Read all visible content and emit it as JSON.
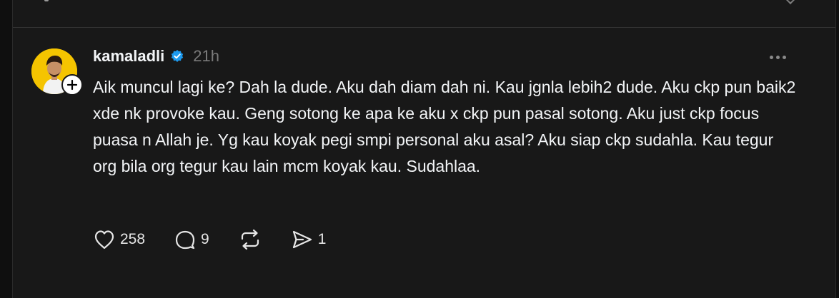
{
  "post": {
    "username": "kamaladli",
    "timestamp": "21h",
    "verified": true,
    "text": "Aik muncul lagi ke? Dah la dude. Aku dah diam dah ni. Kau jgnla lebih2 dude. Aku ckp pun baik2 xde nk provoke kau. Geng sotong ke apa ke aku x ckp pun pasal sotong. Aku just ckp focus puasa n Allah je. Yg kau koyak pegi smpi personal aku asal? Aku siap ckp sudahla. Kau tegur org bila org tegur kau lain mcm koyak kau. Sudahlaa.",
    "avatar_bg": "#f5c400",
    "verified_color": "#1d9bf0"
  },
  "actions": {
    "likes": "258",
    "replies": "9",
    "shares": "1"
  },
  "icons": {
    "like": "heart-icon",
    "reply": "comment-icon",
    "repost": "repost-icon",
    "share": "send-icon",
    "more": "more-icon",
    "follow": "plus-icon",
    "verified": "verified-badge-icon"
  },
  "theme": {
    "background": "#181818",
    "text": "#f3f5f7",
    "muted": "#7a7a7a"
  }
}
